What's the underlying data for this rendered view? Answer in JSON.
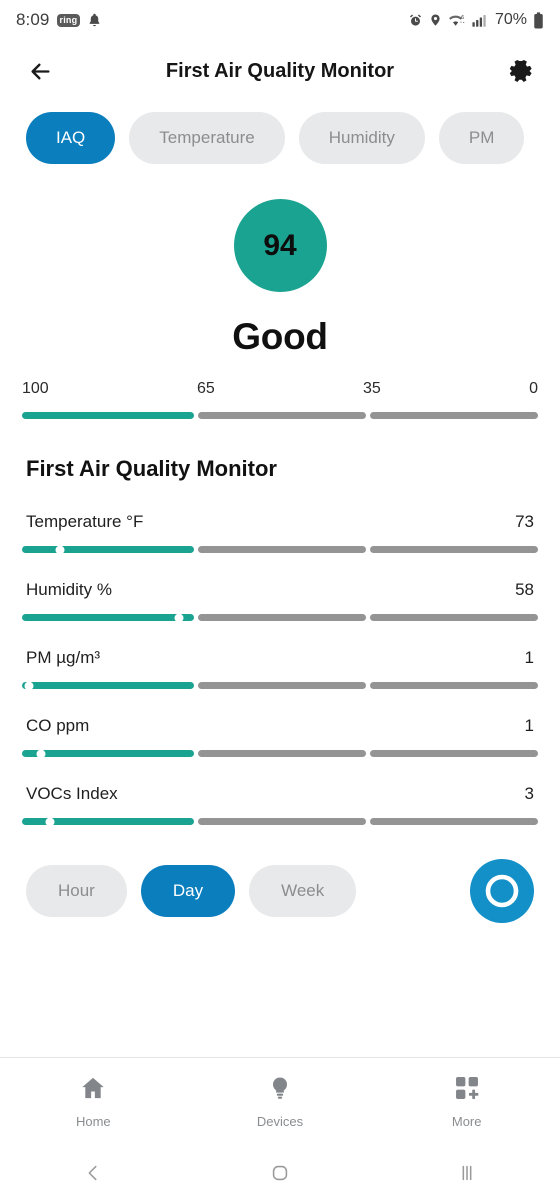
{
  "statusbar": {
    "time": "8:09",
    "app_badge": "ring",
    "battery": "70%",
    "icons": [
      "notification-bell-icon",
      "alarm-clock-icon",
      "location-pin-icon",
      "wifi-icon",
      "cellular-signal-icon",
      "battery-icon"
    ]
  },
  "appbar": {
    "title": "First Air Quality Monitor",
    "back_icon": "back-arrow-icon",
    "settings_icon": "gear-icon"
  },
  "tabs": [
    {
      "label": "IAQ",
      "active": true
    },
    {
      "label": "Temperature",
      "active": false
    },
    {
      "label": "Humidity",
      "active": false
    },
    {
      "label": "PM",
      "active": false
    }
  ],
  "score": {
    "value": "94",
    "rating": "Good",
    "circle_color": "#1ba392"
  },
  "scale": {
    "labels": [
      "100",
      "65",
      "35",
      "0"
    ],
    "segments": [
      {
        "filled": true
      },
      {
        "filled": false
      },
      {
        "filled": false
      }
    ]
  },
  "section": {
    "title": "First Air Quality Monitor"
  },
  "metrics": [
    {
      "label": "Temperature °F",
      "value": "73",
      "marker_pct": 22,
      "filled": true
    },
    {
      "label": "Humidity %",
      "value": "58",
      "marker_pct": 91,
      "filled": true
    },
    {
      "label": "PM µg/m³",
      "value": "1",
      "marker_pct": 4,
      "filled": true
    },
    {
      "label": "CO ppm",
      "value": "1",
      "marker_pct": 11,
      "filled": true
    },
    {
      "label": "VOCs Index",
      "value": "3",
      "marker_pct": 16,
      "filled": true
    }
  ],
  "ranges": [
    {
      "label": "Hour",
      "active": false
    },
    {
      "label": "Day",
      "active": true
    },
    {
      "label": "Week",
      "active": false
    }
  ],
  "fab": {
    "icon": "assistant-bubble-icon",
    "color": "#1390c8"
  },
  "bottomnav": [
    {
      "label": "Home",
      "icon": "home-icon"
    },
    {
      "label": "Devices",
      "icon": "lightbulb-icon"
    },
    {
      "label": "More",
      "icon": "grid-plus-icon"
    }
  ],
  "sysnav": [
    {
      "icon": "system-back-icon"
    },
    {
      "icon": "system-home-icon"
    },
    {
      "icon": "system-recents-icon"
    }
  ],
  "colors": {
    "accent_blue": "#0b7ebe",
    "accent_teal": "#1ba392",
    "track_gray": "#949494",
    "chip_gray": "#e8e9ea"
  }
}
